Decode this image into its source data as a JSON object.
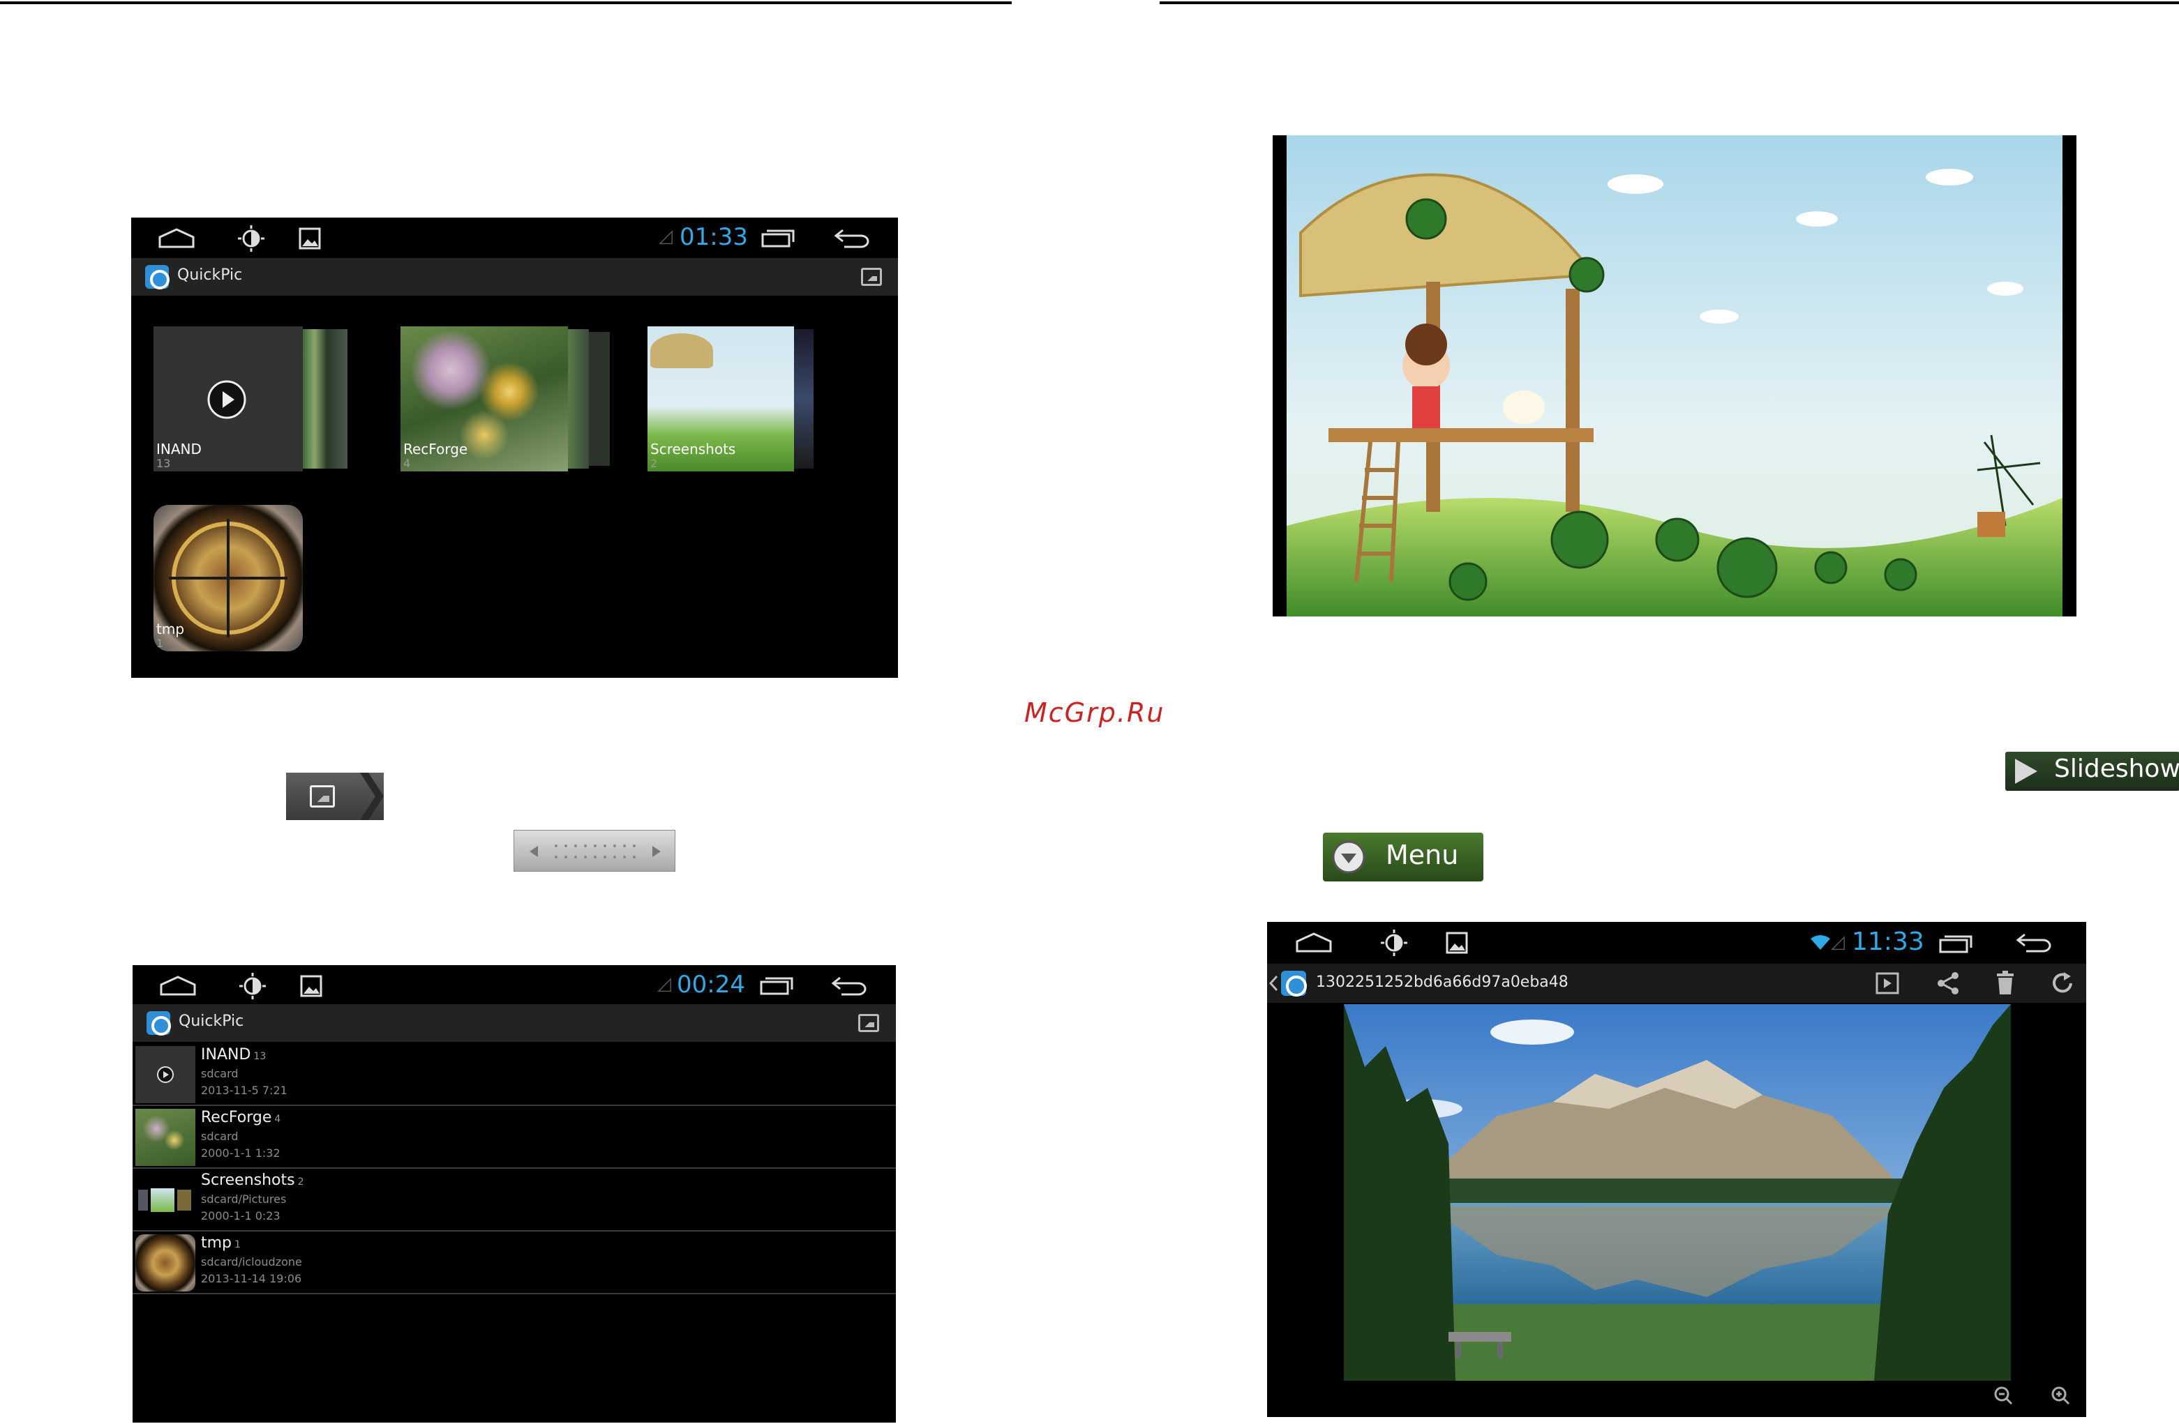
{
  "watermark": "McGrp.Ru",
  "screen_grid": {
    "clock": "01:33",
    "app_title": "QuickPic",
    "albums": [
      {
        "name": "INAND",
        "count": "13"
      },
      {
        "name": "RecForge",
        "count": "4"
      },
      {
        "name": "Screenshots",
        "count": "2"
      },
      {
        "name": "tmp",
        "count": "1"
      }
    ]
  },
  "screen_list": {
    "clock": "00:24",
    "app_title": "QuickPic",
    "rows": [
      {
        "name": "INAND",
        "count": "13",
        "path": "sdcard",
        "date": "2013-11-5 7:21"
      },
      {
        "name": "RecForge",
        "count": "4",
        "path": "sdcard",
        "date": "2000-1-1 1:32"
      },
      {
        "name": "Screenshots",
        "count": "2",
        "path": "sdcard/Pictures",
        "date": "2000-1-1 0:23"
      },
      {
        "name": "tmp",
        "count": "1",
        "path": "sdcard/icloudzone",
        "date": "2013-11-14 19:06"
      }
    ]
  },
  "screen_viewer": {
    "clock": "11:33",
    "file_title": "1302251252bd6a66d97a0eba48"
  },
  "buttons": {
    "slideshow_label": "Slideshow",
    "menu_label": "Menu"
  },
  "icons": {
    "home": "home-icon",
    "brightness": "brightness-icon",
    "gallery": "gallery-icon",
    "recents": "recents-icon",
    "back": "back-icon",
    "play": "play-icon",
    "share": "share-icon",
    "delete": "trash-icon",
    "rotate": "rotate-icon",
    "zoom_out": "zoom-out-icon",
    "zoom_in": "zoom-in-icon"
  }
}
